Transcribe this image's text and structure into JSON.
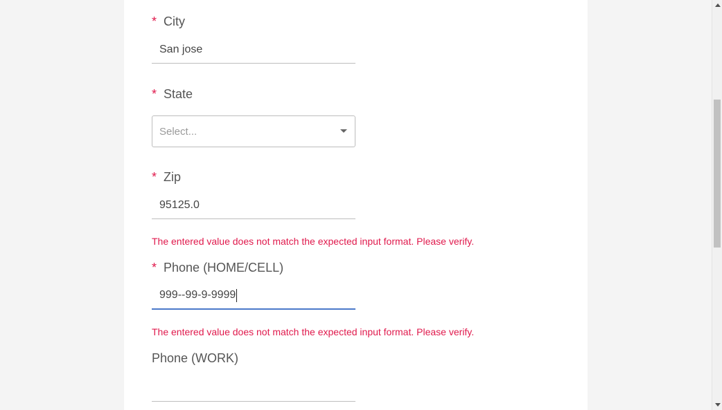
{
  "form": {
    "city": {
      "required_mark": "*",
      "label": "City",
      "value": "San jose"
    },
    "state": {
      "required_mark": "*",
      "label": "State",
      "placeholder": "Select..."
    },
    "zip": {
      "required_mark": "*",
      "label": "Zip",
      "value": "95125.0",
      "error": "The entered value does not match the expected input format. Please verify."
    },
    "phone_home": {
      "required_mark": "*",
      "label": "Phone (HOME/CELL)",
      "value": "999--99-9-9999",
      "error": "The entered value does not match the expected input format. Please verify."
    },
    "phone_work": {
      "label": "Phone (WORK)",
      "value": ""
    }
  },
  "colors": {
    "required": "#e0194c",
    "error": "#e0194c",
    "focus_underline": "#4a78c9"
  }
}
